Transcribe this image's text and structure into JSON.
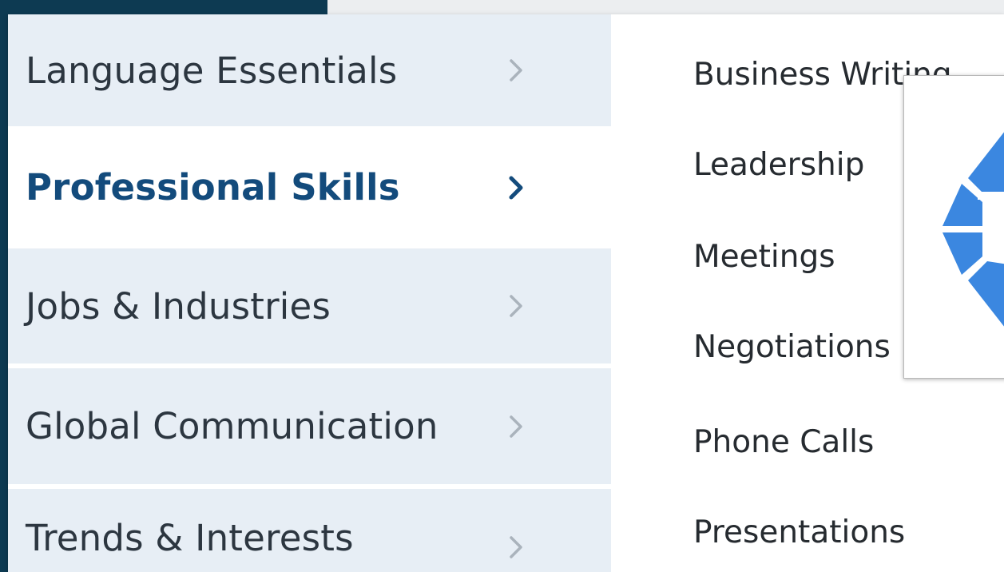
{
  "categories": [
    {
      "label": "Language Essentials",
      "active": false
    },
    {
      "label": "Professional Skills",
      "active": true
    },
    {
      "label": "Jobs & Industries",
      "active": false
    },
    {
      "label": "Global Communication",
      "active": false
    },
    {
      "label": "Trends & Interests",
      "active": false
    }
  ],
  "subcategories": [
    {
      "label": "Business Writing"
    },
    {
      "label": "Leadership"
    },
    {
      "label": "Meetings"
    },
    {
      "label": "Negotiations"
    },
    {
      "label": "Phone Calls"
    },
    {
      "label": "Presentations"
    }
  ],
  "colors": {
    "background_dark": "#0d3a52",
    "category_bg": "#e7eef5",
    "active_text": "#134b7c",
    "spinner_blue": "#3b87e0",
    "chevron_inactive": "#aab3bc"
  },
  "icons": {
    "chevron": "chevron-right-icon",
    "spinner": "loading-spinner-icon"
  }
}
